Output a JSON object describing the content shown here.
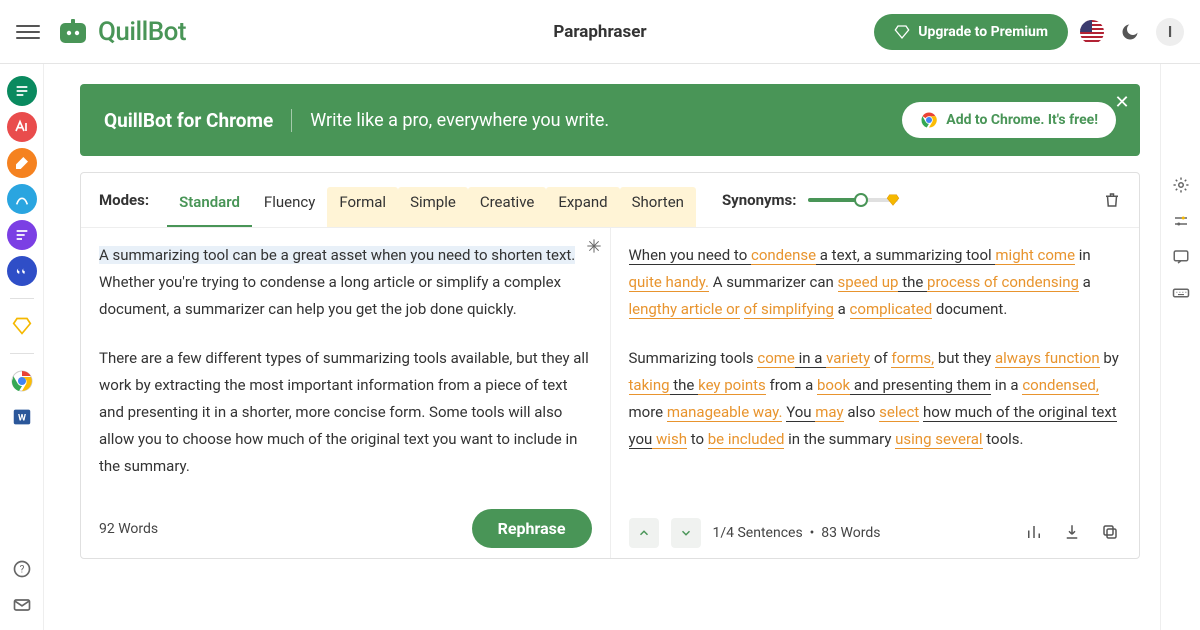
{
  "header": {
    "logo_text": "QuillBot",
    "title": "Paraphraser",
    "upgrade_label": "Upgrade to Premium",
    "avatar_initial": "I"
  },
  "banner": {
    "title": "QuillBot for Chrome",
    "subtitle": "Write like a pro, everywhere you write.",
    "cta_label": "Add to Chrome. It's free!"
  },
  "modes": {
    "label": "Modes:",
    "items": [
      "Standard",
      "Fluency",
      "Formal",
      "Simple",
      "Creative",
      "Expand",
      "Shorten"
    ],
    "active": "Standard",
    "premium_start_index": 2
  },
  "synonyms_label": "Synonyms:",
  "input": {
    "p1": "A summarizing tool can be a great asset when you need to shorten text. Whether you're trying to condense a long article or simplify a complex document, a summarizer can help you get the job done quickly.",
    "p1_highlight": "A summarizing tool can be a great asset when you need to shorten text.",
    "p2": "There are a few different types of summarizing tools available, but they all work by extracting the most important information from a piece of text and presenting it in a shorter, more concise form. Some tools will also allow you to choose how much of the original text you want to include in the summary.",
    "wordcount": "92 Words",
    "action_label": "Rephrase"
  },
  "output": {
    "segments1": [
      {
        "t": "When you need to ",
        "c": "u"
      },
      {
        "t": "condense",
        "c": "y"
      },
      {
        "t": " a text, a summarizing tool ",
        "c": "u"
      },
      {
        "t": "might come",
        "c": "y"
      },
      {
        "t": " in ",
        "c": ""
      },
      {
        "t": "quite handy.",
        "c": "y"
      },
      {
        "t": " A summarizer can ",
        "c": ""
      },
      {
        "t": "speed up",
        "c": "y"
      },
      {
        "t": " the ",
        "c": "u"
      },
      {
        "t": "process of condensing",
        "c": "y"
      },
      {
        "t": " a ",
        "c": ""
      },
      {
        "t": "lengthy article or",
        "c": "y"
      },
      {
        "t": " ",
        "c": ""
      },
      {
        "t": "of simplifying",
        "c": "y"
      },
      {
        "t": " a ",
        "c": ""
      },
      {
        "t": "complicated",
        "c": "y"
      },
      {
        "t": " document.",
        "c": ""
      }
    ],
    "segments2": [
      {
        "t": "Summarizing tools ",
        "c": ""
      },
      {
        "t": "come",
        "c": "y"
      },
      {
        "t": " in a ",
        "c": "u"
      },
      {
        "t": "variety",
        "c": "y"
      },
      {
        "t": " of ",
        "c": ""
      },
      {
        "t": "forms,",
        "c": "y"
      },
      {
        "t": " but they ",
        "c": ""
      },
      {
        "t": "always function",
        "c": "y"
      },
      {
        "t": " by ",
        "c": ""
      },
      {
        "t": "taking",
        "c": "y"
      },
      {
        "t": " the ",
        "c": "u"
      },
      {
        "t": "key points",
        "c": "y"
      },
      {
        "t": " from a ",
        "c": ""
      },
      {
        "t": "book",
        "c": "y"
      },
      {
        "t": " and presenting them",
        "c": "u"
      },
      {
        "t": " in a ",
        "c": ""
      },
      {
        "t": "condensed,",
        "c": "y"
      },
      {
        "t": " more ",
        "c": ""
      },
      {
        "t": "manageable way.",
        "c": "y"
      },
      {
        "t": " ",
        "c": ""
      },
      {
        "t": "You ",
        "c": "u"
      },
      {
        "t": "may",
        "c": "y"
      },
      {
        "t": " also ",
        "c": ""
      },
      {
        "t": "select",
        "c": "y"
      },
      {
        "t": " ",
        "c": ""
      },
      {
        "t": "how much of the original text you",
        "c": "u"
      },
      {
        "t": " wish",
        "c": "y"
      },
      {
        "t": " to ",
        "c": ""
      },
      {
        "t": "be included",
        "c": "y"
      },
      {
        "t": " in the summary ",
        "c": ""
      },
      {
        "t": "using several",
        "c": "y"
      },
      {
        "t": " tools.",
        "c": ""
      }
    ],
    "sentence_nav": "1/4 Sentences",
    "wordcount": "83 Words"
  },
  "icons": {
    "premium_diamond": "💎",
    "slider_diamond": "🔶"
  }
}
